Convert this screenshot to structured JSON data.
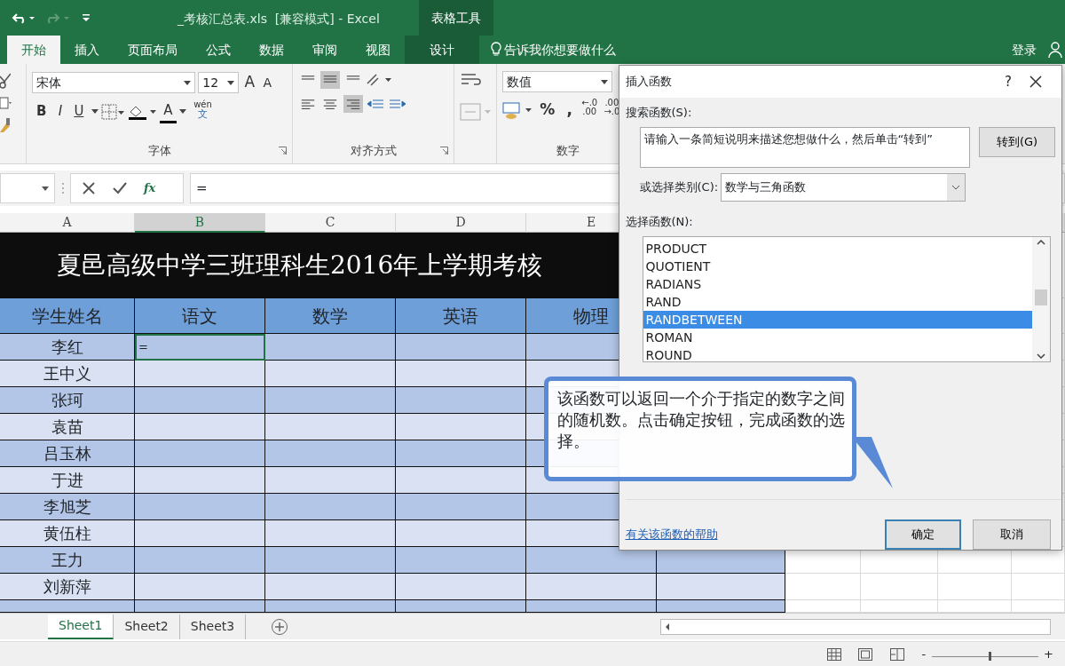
{
  "quick_access": [
    {
      "kind": "undo",
      "disabled": false
    },
    {
      "kind": "redo",
      "disabled": true
    },
    {
      "kind": "customize",
      "disabled": false
    }
  ],
  "window": {
    "title": "_考核汇总表.xls  [兼容模式] - Excel",
    "context_label": "表格工具",
    "sign_in": "登录"
  },
  "ribbon_tabs": [
    {
      "label": "开始",
      "selected": true,
      "contextual": false
    },
    {
      "label": "插入",
      "selected": false,
      "contextual": false
    },
    {
      "label": "页面布局",
      "selected": false,
      "contextual": false
    },
    {
      "label": "公式",
      "selected": false,
      "contextual": false
    },
    {
      "label": "数据",
      "selected": false,
      "contextual": false
    },
    {
      "label": "审阅",
      "selected": false,
      "contextual": false
    },
    {
      "label": "视图",
      "selected": false,
      "contextual": false
    },
    {
      "label": "设计",
      "selected": false,
      "contextual": true
    }
  ],
  "tell_me": {
    "placeholder": "告诉我你想要做什么"
  },
  "ribbon": {
    "font_name": "宋体",
    "font_size": "12",
    "grow_shrink": [
      "A",
      "A"
    ],
    "style_buttons": [
      "B",
      "I",
      "U"
    ],
    "font_color": "A",
    "phonetic": {
      "top": "wén",
      "bottom": "文"
    },
    "font_group": "字体",
    "align_group": "对齐方式",
    "number_format": "数值",
    "number_buttons": [
      "%",
      ","
    ],
    "decimal_buttons": [
      {
        "top": "←.0",
        "bottom": ".00"
      },
      {
        "top": ".00",
        "bottom": "→.0"
      }
    ],
    "number_group": "数字"
  },
  "formula_bar": {
    "fx": "fx",
    "formula": "="
  },
  "sheet": {
    "columns": [
      {
        "label": "A",
        "selected": false
      },
      {
        "label": "B",
        "selected": true
      },
      {
        "label": "C",
        "selected": false
      },
      {
        "label": "D",
        "selected": false
      },
      {
        "label": "E",
        "selected": false
      }
    ],
    "title": "夏邑高级中学三班理科生2016年上学期考核",
    "headers": [
      "学生姓名",
      "语文",
      "数学",
      "英语",
      "物理"
    ],
    "rows": [
      {
        "name": "李红",
        "active": true,
        "entry": "="
      },
      {
        "name": "王中义",
        "active": false
      },
      {
        "name": "张珂",
        "active": false
      },
      {
        "name": "袁苗",
        "active": false
      },
      {
        "name": "吕玉林",
        "active": false
      },
      {
        "name": "于进",
        "active": false
      },
      {
        "name": "李旭芝",
        "active": false
      },
      {
        "name": "黄伍柱",
        "active": false
      },
      {
        "name": "王力",
        "active": false
      },
      {
        "name": "刘新萍",
        "active": false
      }
    ]
  },
  "sheet_tabs": [
    {
      "label": "Sheet1",
      "selected": true
    },
    {
      "label": "Sheet2",
      "selected": false
    },
    {
      "label": "Sheet3",
      "selected": false
    }
  ],
  "status_bar": {
    "zoom_minus": "-",
    "zoom_plus": "+",
    "level": 0.55
  },
  "dialog": {
    "title": "插入函数",
    "help": "?",
    "search_label": "搜索函数(S):",
    "search_value": "请输入一条简短说明来描述您想做什么，然后单击“转到”",
    "go_button": "转到(G)",
    "category_label": "或选择类别(C):",
    "category": "数学与三角函数",
    "list_label": "选择函数(N):",
    "functions": [
      {
        "label": "PRODUCT",
        "selected": false
      },
      {
        "label": "QUOTIENT",
        "selected": false
      },
      {
        "label": "RADIANS",
        "selected": false
      },
      {
        "label": "RAND",
        "selected": false
      },
      {
        "label": "RANDBETWEEN",
        "selected": true
      },
      {
        "label": "ROMAN",
        "selected": false
      },
      {
        "label": "ROUND",
        "selected": false
      }
    ],
    "help_link": "有关该函数的帮助",
    "ok_button": "确定",
    "cancel_button": "取消"
  },
  "callout": {
    "text": "该函数可以返回一个介于指定的数字之间的随机数。点击确定按钮，完成函数的选择。"
  }
}
